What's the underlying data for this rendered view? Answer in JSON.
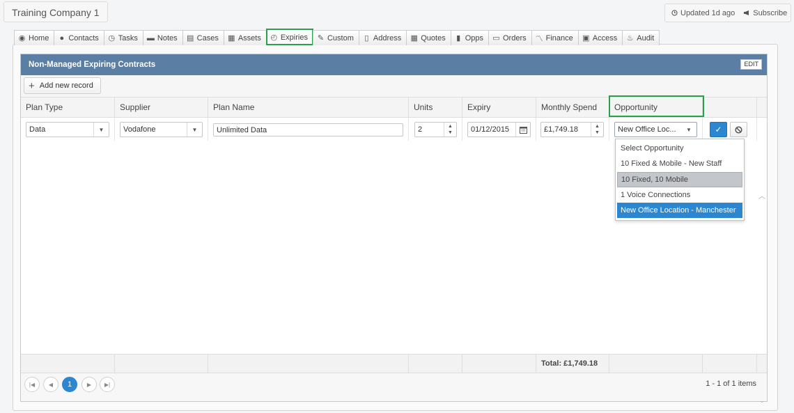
{
  "header": {
    "company": "Training Company 1",
    "updated": "Updated 1d ago",
    "subscribe": "Subscribe"
  },
  "tabs": [
    {
      "label": "Home",
      "icon": "eye-icon"
    },
    {
      "label": "Contacts",
      "icon": "person-icon"
    },
    {
      "label": "Tasks",
      "icon": "clock-icon"
    },
    {
      "label": "Notes",
      "icon": "comment-icon"
    },
    {
      "label": "Cases",
      "icon": "briefcase-icon"
    },
    {
      "label": "Assets",
      "icon": "grid-icon"
    },
    {
      "label": "Expiries",
      "icon": "stopwatch-icon",
      "active": true
    },
    {
      "label": "Custom",
      "icon": "wrench-icon"
    },
    {
      "label": "Address",
      "icon": "book-icon"
    },
    {
      "label": "Quotes",
      "icon": "calculator-icon"
    },
    {
      "label": "Opps",
      "icon": "tablet-icon"
    },
    {
      "label": "Orders",
      "icon": "credit-card-icon"
    },
    {
      "label": "Finance",
      "icon": "line-chart-icon"
    },
    {
      "label": "Access",
      "icon": "lock-icon"
    },
    {
      "label": "Audit",
      "icon": "fire-icon"
    }
  ],
  "panel": {
    "title": "Non-Managed Expiring Contracts",
    "edit": "EDIT",
    "add_label": "Add new record"
  },
  "columns": [
    "Plan Type",
    "Supplier",
    "Plan Name",
    "Units",
    "Expiry",
    "Monthly Spend",
    "Opportunity"
  ],
  "row": {
    "plan_type": "Data",
    "supplier": "Vodafone",
    "plan_name": "Unlimited Data",
    "units": "2",
    "expiry": "01/12/2015",
    "monthly_spend": "£1,749.18",
    "opportunity": "New Office Loc..."
  },
  "dropdown": {
    "options": [
      {
        "label": "Select Opportunity",
        "state": "normal"
      },
      {
        "label": "10 Fixed & Mobile - New Staff",
        "state": "normal"
      },
      {
        "label": "10 Fixed, 10 Mobile",
        "state": "hover"
      },
      {
        "label": "1 Voice Connections",
        "state": "normal"
      },
      {
        "label": "New Office Location - Manchester",
        "state": "selected"
      }
    ]
  },
  "footer": {
    "total": "Total: £1,749.18"
  },
  "pager": {
    "current_page": "1",
    "info": "1 - 1 of 1 items"
  },
  "colors": {
    "header_bar": "#5a7ea4",
    "accent": "#2d86d0",
    "highlight": "#2aa04a"
  }
}
